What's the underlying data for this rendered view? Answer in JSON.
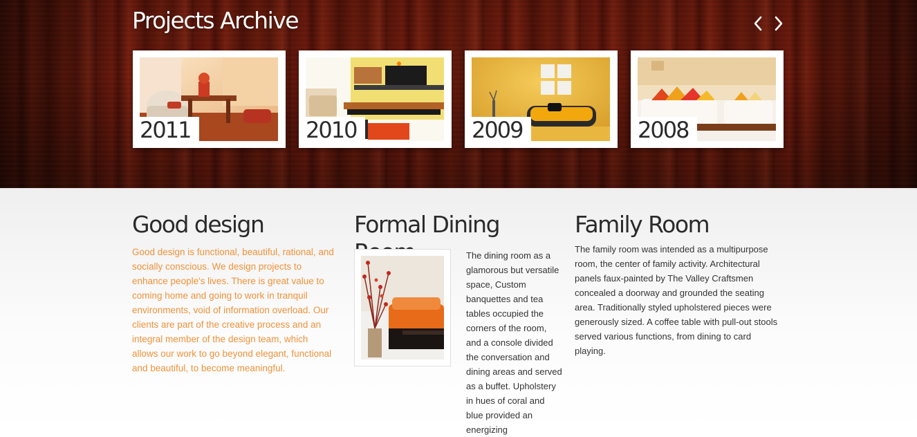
{
  "banner": {
    "title": "Projects Archive",
    "prev_icon": "chevron-left-icon",
    "next_icon": "chevron-right-icon",
    "projects": [
      {
        "year": "2011"
      },
      {
        "year": "2010"
      },
      {
        "year": "2009"
      },
      {
        "year": "2008"
      }
    ]
  },
  "columns": {
    "good_design": {
      "heading": "Good design",
      "text": "Good design is functional, beautiful, rational, and socially conscious. We design projects to enhance people's lives. There is great value to coming home and going to work in tranquil environments, void of information overload. Our clients are part of the creative process and an integral member of the design team, which allows our work to go beyond elegant, functional and beautiful, to become meaningful."
    },
    "formal_dining": {
      "heading": "Formal Dining Room",
      "text": "The dining room as a glamorous but versatile space, Custom banquettes and tea tables occupied the corners of the room, and a console divided the conversation and dining areas and served as a buffet. Upholstery in hues of coral and blue provided an energizing"
    },
    "family_room": {
      "heading": "Family Room",
      "text": "The family room was intended as a multipurpose room, the center of family activity. Architectural panels faux-painted by The Valley Craftsmen concealed a doorway and grounded the seating area. Traditionally styled upholstered pieces were generously sized. A coffee table with pull-out stools served various functions, from dining to card playing."
    }
  },
  "colors": {
    "accent_text": "#f0923a",
    "heading": "#2a2a2a",
    "wood": "#5b150a"
  }
}
